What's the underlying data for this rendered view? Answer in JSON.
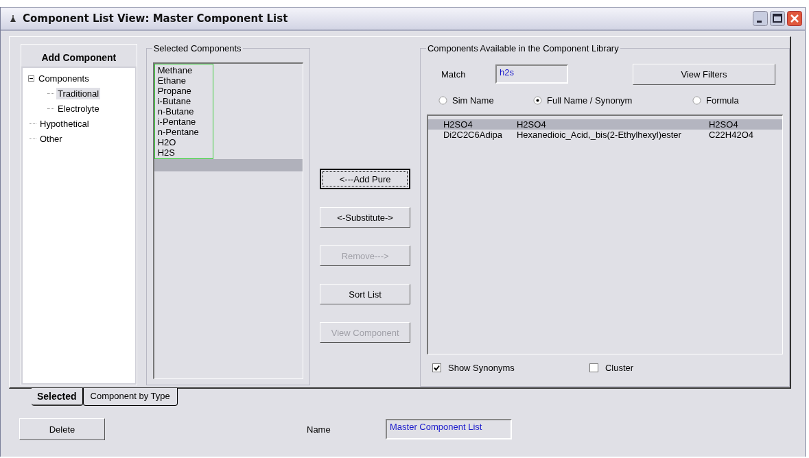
{
  "window": {
    "title": "Component List View: Master Component List"
  },
  "tree": {
    "title": "Add Component",
    "items": [
      {
        "label": "Components",
        "expanded": true,
        "selected": false,
        "children": [
          {
            "label": "Traditional",
            "selected": true
          },
          {
            "label": "Electrolyte",
            "selected": false
          }
        ]
      },
      {
        "label": "Hypothetical",
        "selected": false
      },
      {
        "label": "Other",
        "selected": false
      }
    ]
  },
  "selected_components": {
    "title": "Selected Components",
    "items": [
      {
        "label": "Methane",
        "selected": false
      },
      {
        "label": "Ethane",
        "selected": false
      },
      {
        "label": "Propane",
        "selected": false
      },
      {
        "label": "i-Butane",
        "selected": false
      },
      {
        "label": "n-Butane",
        "selected": false
      },
      {
        "label": "i-Pentane",
        "selected": false
      },
      {
        "label": "n-Pentane",
        "selected": false
      },
      {
        "label": "H2O",
        "selected": false
      },
      {
        "label": "H2S",
        "selected": false
      }
    ],
    "empty_row_selected": true
  },
  "actions": [
    {
      "label": "<---Add Pure",
      "focused": true,
      "disabled": false
    },
    {
      "label": "<-Substitute->",
      "focused": false,
      "disabled": false
    },
    {
      "label": "Remove--->",
      "focused": false,
      "disabled": true
    },
    {
      "label": "Sort List",
      "focused": false,
      "disabled": false
    },
    {
      "label": "View Component",
      "focused": false,
      "disabled": true
    }
  ],
  "library": {
    "title": "Components Available in the Component Library",
    "match_label": "Match",
    "match_value": "h2s",
    "filter_button": "View Filters",
    "search_by": [
      {
        "label": "Sim Name",
        "selected": false
      },
      {
        "label": "Full Name / Synonym",
        "selected": true
      },
      {
        "label": "Formula",
        "selected": false
      }
    ],
    "results": [
      {
        "sim_name": "H2SO4",
        "full_name": "H2SO4",
        "formula": "H2SO4",
        "selected": true
      },
      {
        "sim_name": "Di2C2C6Adipa",
        "full_name": "Hexanedioic_Acid,_bis(2-Ethylhexyl)ester",
        "formula": "C22H42O4",
        "selected": false
      }
    ],
    "options": [
      {
        "label": "Show Synonyms",
        "checked": true
      },
      {
        "label": "Cluster",
        "checked": false
      }
    ]
  },
  "tabs": [
    {
      "label": "Selected",
      "selected": true
    },
    {
      "label": "Component by Type",
      "selected": false
    }
  ],
  "footer": {
    "delete_button": "Delete",
    "name_label": "Name",
    "name_value": "Master Component List"
  }
}
